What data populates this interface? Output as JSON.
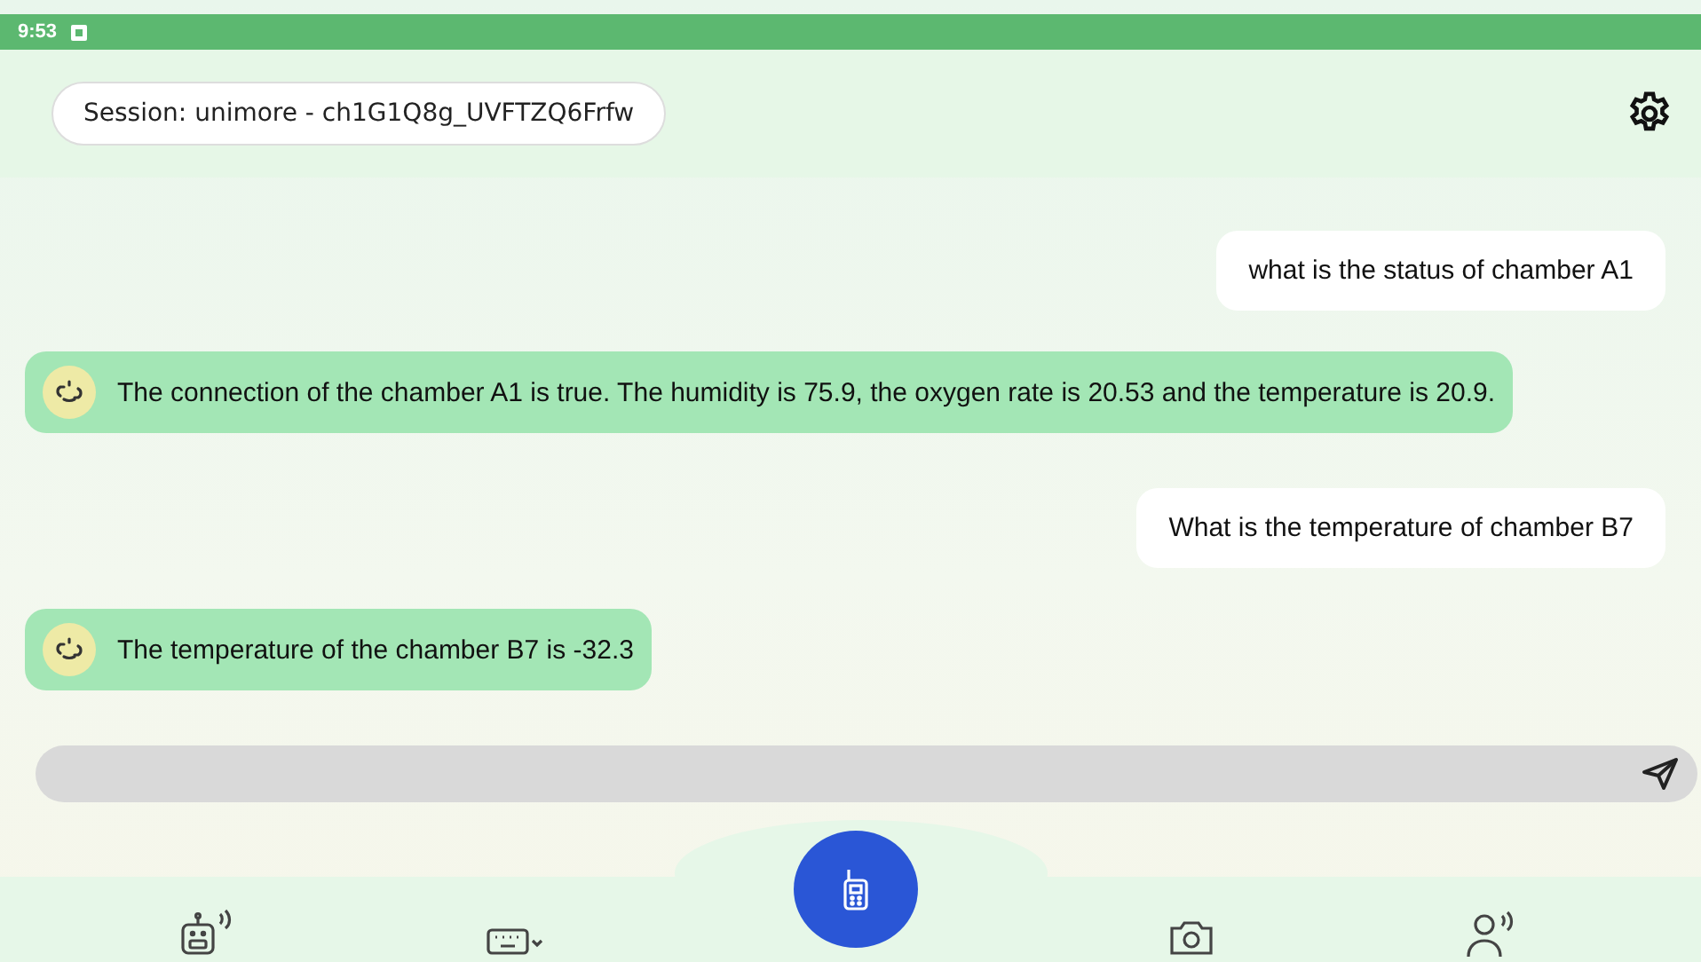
{
  "status_bar": {
    "time": "9:53"
  },
  "session": {
    "label": "Session: unimore - ch1G1Q8g_UVFTZQ6Frfw"
  },
  "messages": [
    {
      "kind": "user",
      "text": "what is the status of chamber A1"
    },
    {
      "kind": "bot",
      "text": "The connection of the chamber A1 is true. The humidity is 75.9, the oxygen rate is 20.53 and the temperature is 20.9."
    },
    {
      "kind": "user",
      "text": "What is the temperature of chamber B7"
    },
    {
      "kind": "bot",
      "text": "The temperature of the chamber B7 is -32.3"
    }
  ],
  "nav": [
    {
      "kind": "robot"
    },
    {
      "kind": "keyboard"
    },
    {
      "kind": "walkie"
    },
    {
      "kind": "camera"
    },
    {
      "kind": "voice"
    }
  ]
}
